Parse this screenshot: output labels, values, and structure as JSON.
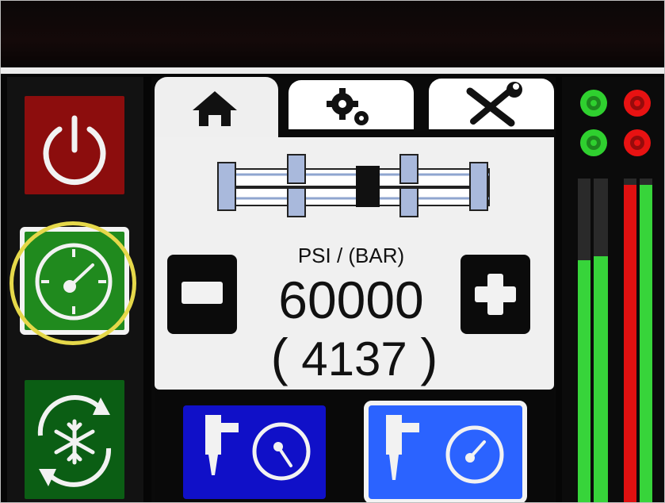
{
  "colors": {
    "power_tile": "#8c0d0d",
    "gauge_tile": "#208a1e",
    "snow_tile": "#0b5e14",
    "mode_left": "#1010c8",
    "mode_right": "#2b63ff",
    "highlight_ring": "#e5d84a",
    "green_meter": "#37d43a",
    "red_meter": "#e01010"
  },
  "sidebar": {
    "items": [
      {
        "name": "power",
        "icon": "power-icon"
      },
      {
        "name": "pressure-gauge",
        "icon": "gauge-icon",
        "highlighted": true
      },
      {
        "name": "cooling",
        "icon": "snowflake-cycle-icon"
      }
    ]
  },
  "tabs": [
    {
      "name": "home",
      "icon": "home-icon",
      "selected": true
    },
    {
      "name": "settings",
      "icon": "gears-icon",
      "selected": false
    },
    {
      "name": "tools",
      "icon": "wrench-screwdriver-icon",
      "selected": false
    }
  ],
  "pressure": {
    "unit_label": "PSI / (BAR)",
    "psi_value": "60000",
    "bar_value": "4137",
    "open_paren": "(",
    "close_paren": ")"
  },
  "controls": {
    "decrease_icon": "minus-icon",
    "increase_icon": "plus-icon"
  },
  "modes": [
    {
      "name": "mode-spray",
      "icon": "nozzle-gauge-icon",
      "selected": false
    },
    {
      "name": "mode-nozzle",
      "icon": "nozzle-gauge-icon",
      "selected": true
    }
  ],
  "status": {
    "green_leds": 2,
    "red_leds": 2,
    "meters": [
      {
        "color": "green",
        "level": 0.75
      },
      {
        "color": "green",
        "level": 0.76
      },
      {
        "color": "red",
        "level": 0.98
      },
      {
        "color": "green",
        "level": 0.98
      }
    ]
  }
}
